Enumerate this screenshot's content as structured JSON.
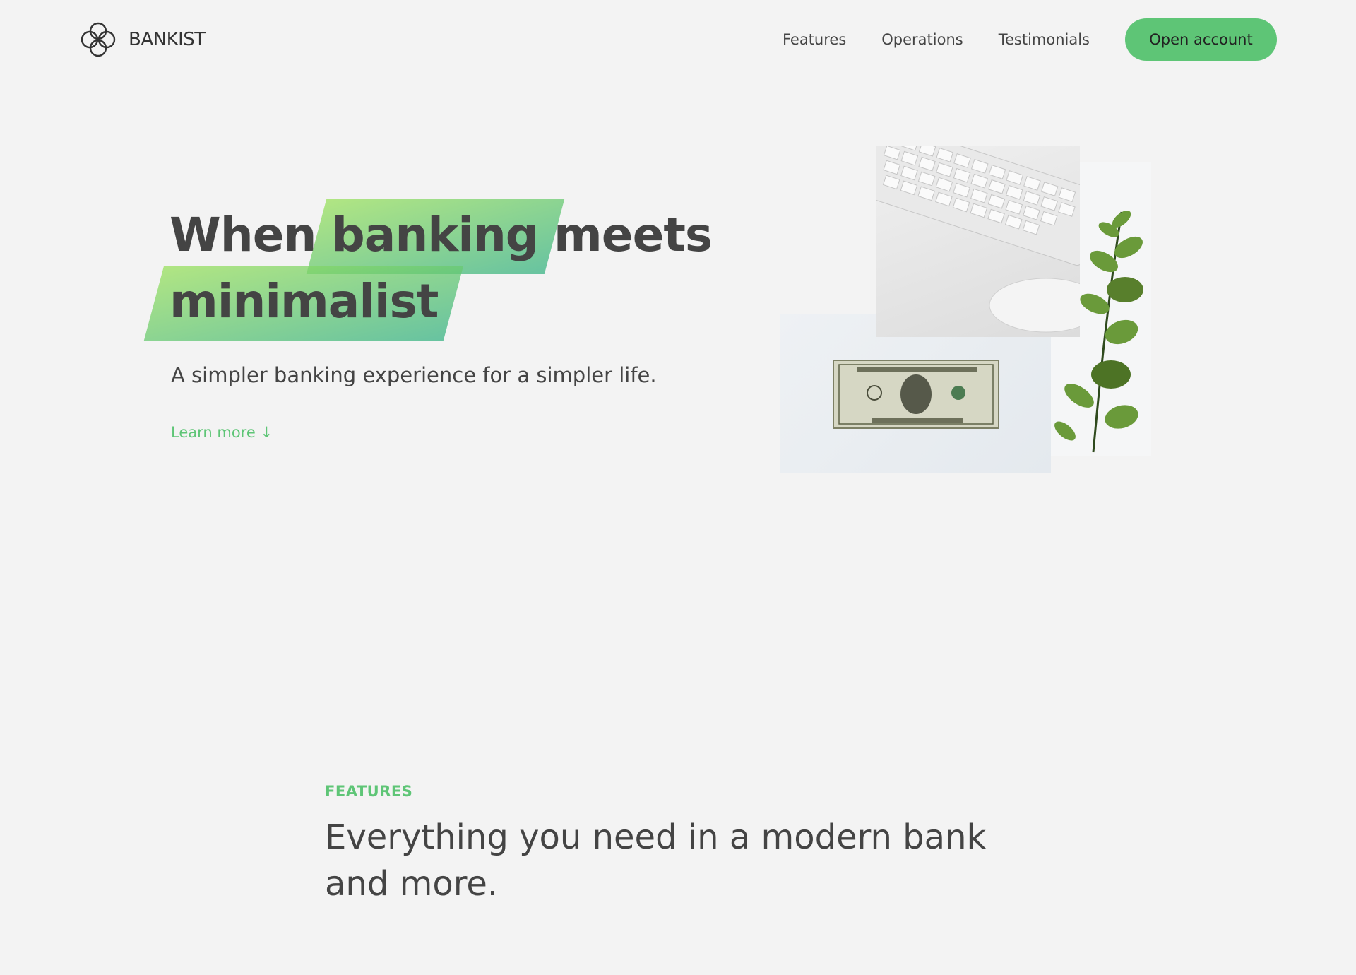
{
  "brand": {
    "name": "BANKIST",
    "accent_color": "#5ec576"
  },
  "nav": {
    "links": [
      "Features",
      "Operations",
      "Testimonials"
    ],
    "cta_label": "Open account"
  },
  "hero": {
    "title_part1": "When",
    "title_highlight1": "banking",
    "title_part2": "meets",
    "title_highlight2": "minimalist",
    "subtitle": "A simpler banking experience for a simpler life.",
    "learn_more": "Learn more ↓"
  },
  "features": {
    "label": "FEATURES",
    "title": "Everything you need in a modern bank and more."
  }
}
